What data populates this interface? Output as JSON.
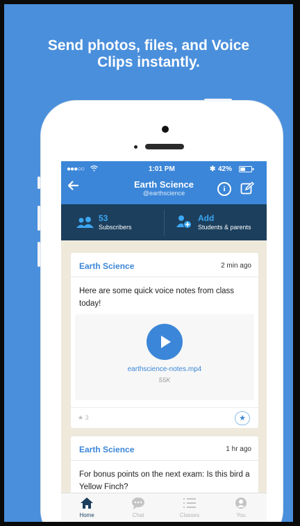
{
  "headline": {
    "line1": "Send photos, files, and Voice",
    "line2": "Clips instantly."
  },
  "status_bar": {
    "signal": "●●●○○",
    "time": "1:01 PM",
    "battery": "42%"
  },
  "header": {
    "title": "Earth Science",
    "subtitle": "@earthscience"
  },
  "stats": {
    "subscribers_count": "53",
    "subscribers_label": "Subscribers",
    "add_title": "Add",
    "add_label": "Students & parents"
  },
  "posts": [
    {
      "author": "Earth Science",
      "time": "2 min ago",
      "text": "Here are some quick voice notes from class today!",
      "file_name": "earthscience-notes.mp4",
      "file_size": "55K",
      "stars": "★ 3"
    },
    {
      "author": "Earth Science",
      "time": "1 hr ago",
      "text": "For bonus points on the next exam: Is this bird a Yellow Finch?"
    }
  ],
  "tabs": [
    {
      "label": "Home",
      "icon": "home-icon",
      "active": true
    },
    {
      "label": "Chat",
      "icon": "chat-icon",
      "active": false
    },
    {
      "label": "Classes",
      "icon": "classes-icon",
      "active": false
    },
    {
      "label": "You",
      "icon": "profile-icon",
      "active": false
    }
  ],
  "colors": {
    "background": "#4a8fdc",
    "accent": "#3b86d8",
    "nav_dark": "#1c3f5d",
    "feed": "#efe9dc"
  }
}
